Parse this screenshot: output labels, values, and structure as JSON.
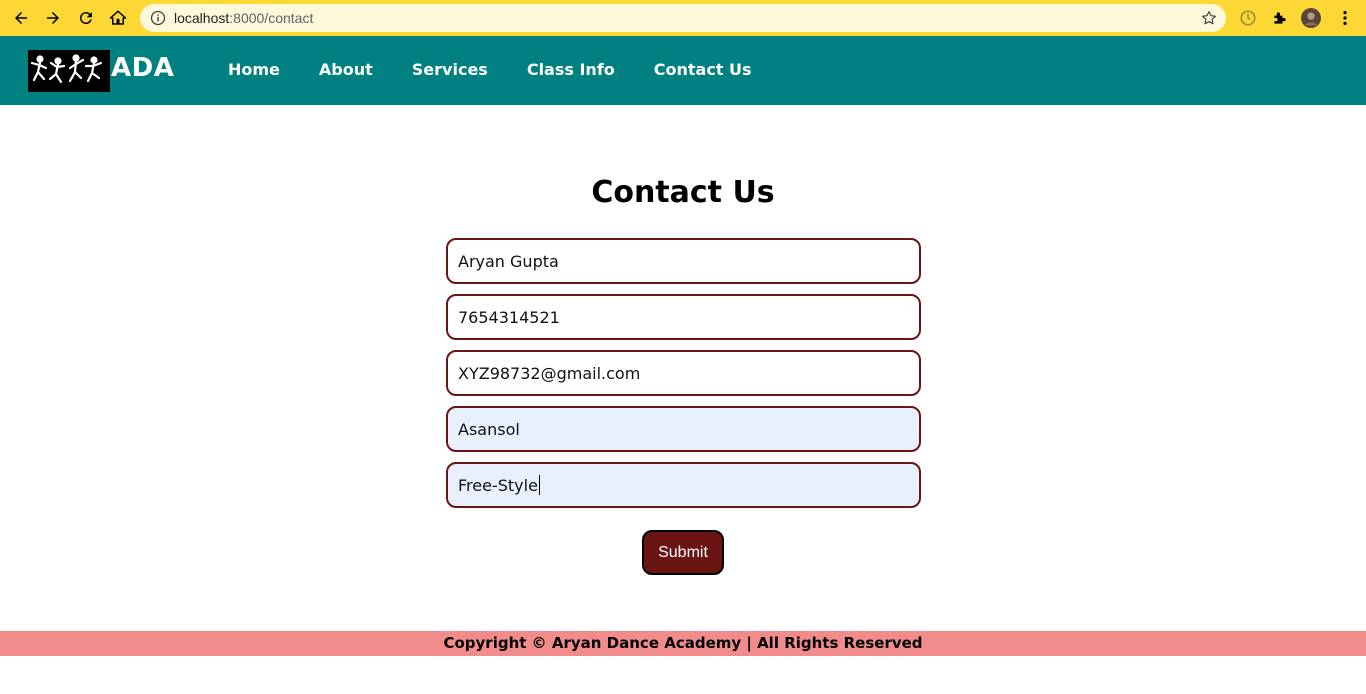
{
  "browser": {
    "url_host": "localhost",
    "url_path": ":8000/contact"
  },
  "site": {
    "logo_text": "ADA",
    "nav": [
      "Home",
      "About",
      "Services",
      "Class Info",
      "Contact Us"
    ]
  },
  "main": {
    "title": "Contact Us",
    "fields": {
      "name": "Aryan Gupta",
      "phone": "7654314521",
      "email": "XYZ98732@gmail.com",
      "city": "Asansol",
      "style": "Free-Style"
    },
    "submit_label": "Submit"
  },
  "footer": {
    "text": "Copyright © Aryan Dance Academy | All Rights Reserved"
  },
  "colors": {
    "chrome": "#fdd835",
    "header": "#008080",
    "accent": "#6b1414",
    "footer": "#f28b8b",
    "autofill": "#e8f0fe"
  }
}
